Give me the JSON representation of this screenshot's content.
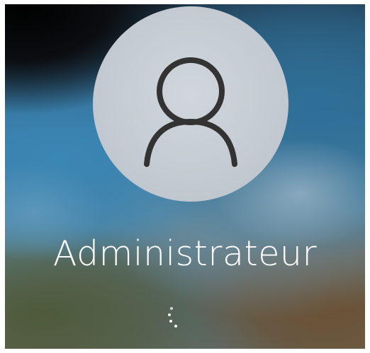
{
  "login": {
    "username": "Administrateur",
    "avatar_icon": "user-silhouette-icon",
    "status_icon": "loading-spinner-icon"
  },
  "colors": {
    "text": "#ffffff",
    "avatar_bg": "#c6cdd4",
    "avatar_icon_stroke": "#333333"
  }
}
